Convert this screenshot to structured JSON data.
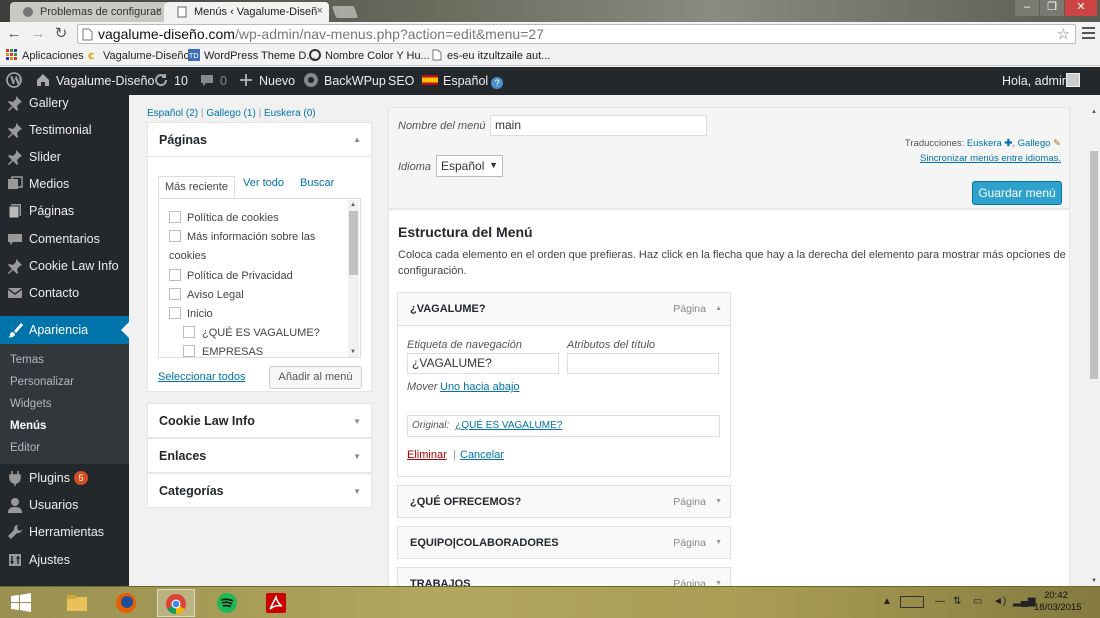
{
  "browser": {
    "tabs": [
      {
        "title": "Problemas de configurac"
      },
      {
        "title": "Menús ‹ Vagalume-Diseñ"
      }
    ],
    "url_host": "vagalume-diseño.com",
    "url_path": "/wp-admin/nav-menus.php?action=edit&menu=27",
    "bookmarks": [
      "Aplicaciones",
      "Vagalume-Diseño",
      "WordPress Theme D...",
      "Nombre Color Y Hu...",
      "es-eu itzultzaile aut..."
    ]
  },
  "adminbar": {
    "site": "Vagalume-Diseño",
    "updates": "10",
    "comments": "0",
    "new": "Nuevo",
    "backwpup": "BackWPup",
    "seo": "SEO",
    "lang": "Español",
    "greeting": "Hola, admin"
  },
  "sidebar": {
    "items": [
      {
        "label": "Gallery",
        "icon": "pin-icon"
      },
      {
        "label": "Testimonial",
        "icon": "pin-icon"
      },
      {
        "label": "Slider",
        "icon": "pin-icon"
      },
      {
        "label": "Medios",
        "icon": "media-icon"
      },
      {
        "label": "Páginas",
        "icon": "page-icon"
      },
      {
        "label": "Comentarios",
        "icon": "comment-icon"
      },
      {
        "label": "Cookie Law Info",
        "icon": "pin-icon"
      },
      {
        "label": "Contacto",
        "icon": "mail-icon"
      },
      {
        "label": "Apariencia",
        "icon": "brush-icon"
      }
    ],
    "submenu": [
      "Temas",
      "Personalizar",
      "Widgets",
      "Menús",
      "Editor"
    ],
    "lower": [
      {
        "label": "Plugins",
        "icon": "plug-icon",
        "badge": "5"
      },
      {
        "label": "Usuarios",
        "icon": "user-icon"
      },
      {
        "label": "Herramientas",
        "icon": "wrench-icon"
      },
      {
        "label": "Ajustes",
        "icon": "settings-icon"
      }
    ]
  },
  "lang_links": {
    "es": "Español (2)",
    "gl": "Gallego (1)",
    "eu": "Euskera (0)",
    "sep": "|"
  },
  "paginas_panel": {
    "title": "Páginas",
    "tabs": [
      "Más reciente",
      "Ver todo",
      "Buscar"
    ],
    "items": [
      "Política de cookies",
      "Más información sobre las",
      "cookies",
      "Política de Privacidad",
      "Aviso Legal",
      "Inicio",
      "¿QUÉ ES VAGALUME?",
      "EMPRESAS"
    ],
    "select_all": "Seleccionar todos",
    "add_button": "Añadir al menú"
  },
  "collapsed_panels": [
    "Cookie Law Info",
    "Enlaces",
    "Categorías"
  ],
  "menu_settings": {
    "name_label": "Nombre del menú",
    "name_value": "main",
    "idioma_label": "Idioma",
    "idioma_value": "Español",
    "trad_label": "Traducciones:",
    "trad_eu": "Euskera",
    "trad_gl": "Gallego",
    "sync": "Sincronizar menús entre idiomas.",
    "save": "Guardar menú"
  },
  "structure": {
    "title": "Estructura del Menú",
    "description": "Coloca cada elemento en el orden que prefieras. Haz click en la flecha que hay a la derecha del elemento para mostrar más opciones de configuración.",
    "open_item": {
      "title": "¿VAGALUME?",
      "type": "Página",
      "nav_label": "Etiqueta de navegación",
      "nav_value": "¿VAGALUME?",
      "title_attr_label": "Atributos del título",
      "mover_label": "Mover",
      "mover_link": "Uno hacia abajo",
      "original_label": "Original:",
      "original_link": "¿QUÉ ES VAGALUME?",
      "remove": "Eliminar",
      "sep": "|",
      "cancel": "Cancelar"
    },
    "items": [
      {
        "title": "¿QUÉ OFRECEMOS?",
        "type": "Página"
      },
      {
        "title": "EQUIPO|COLABORADORES",
        "type": "Página"
      },
      {
        "title": "TRABAJOS",
        "type": "Página"
      }
    ]
  },
  "taskbar": {
    "time": "20:42",
    "date": "18/03/2015"
  },
  "colors": {
    "adminbar": "#23282d",
    "accent": "#0073aa",
    "save": "#2ea2cc",
    "badge": "#d54e21"
  }
}
